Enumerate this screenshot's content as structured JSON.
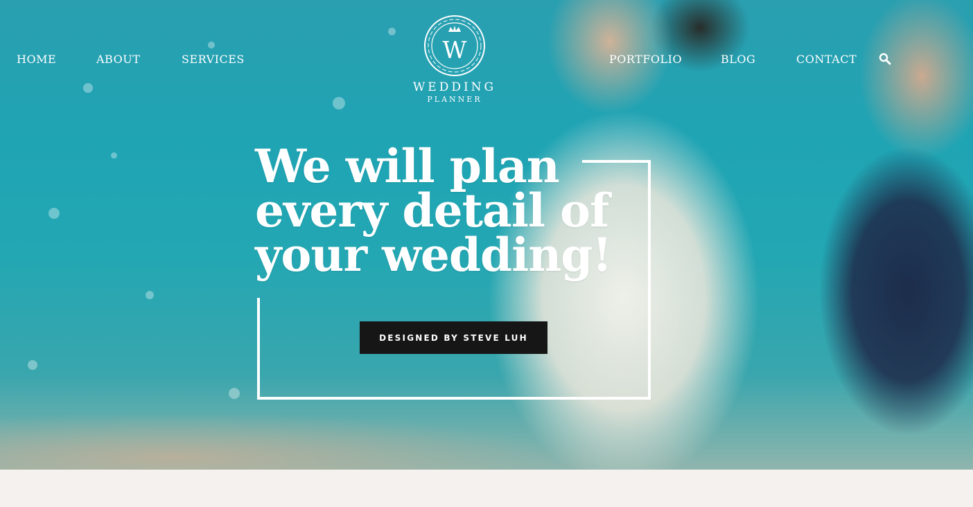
{
  "nav": {
    "left": [
      "HOME",
      "ABOUT",
      "SERVICES"
    ],
    "right": [
      "PORTFOLIO",
      "BLOG",
      "CONTACT"
    ]
  },
  "logo": {
    "monogram": "W",
    "line1": "WEDDING",
    "line2": "PLANNER"
  },
  "hero": {
    "headline_line1": "We will plan",
    "headline_line2": "every detail of",
    "headline_line3": "your wedding!",
    "cta_label": "DESIGNED BY STEVE LUH"
  },
  "icons": {
    "search": "search-icon",
    "crown": "crown-icon"
  },
  "colors": {
    "sea": "#23a7b3",
    "button_bg": "#161616",
    "text": "#ffffff",
    "band": "#f5f1ef"
  }
}
